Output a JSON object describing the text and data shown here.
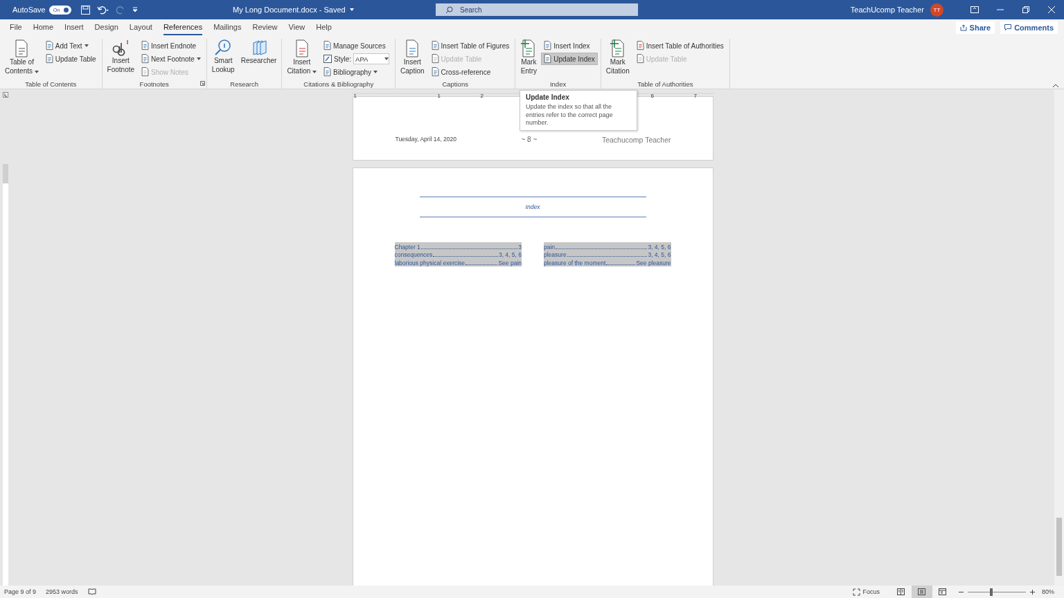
{
  "title_bar": {
    "autosave_label": "AutoSave",
    "autosave_on": true,
    "toggle_text": "On",
    "document_title": "My Long Document.docx  -  Saved",
    "search_placeholder": "Search",
    "user_name": "TeachUcomp Teacher",
    "avatar_initials": "TT"
  },
  "menu_tabs": [
    {
      "label": "File",
      "selected": false
    },
    {
      "label": "Home",
      "selected": false
    },
    {
      "label": "Insert",
      "selected": false
    },
    {
      "label": "Design",
      "selected": false
    },
    {
      "label": "Layout",
      "selected": false
    },
    {
      "label": "References",
      "selected": true
    },
    {
      "label": "Mailings",
      "selected": false
    },
    {
      "label": "Review",
      "selected": false
    },
    {
      "label": "View",
      "selected": false
    },
    {
      "label": "Help",
      "selected": false
    }
  ],
  "share": "Share",
  "comments": "Comments",
  "ribbon_groups": [
    {
      "label": "Table of Contents",
      "large": [
        {
          "lines": [
            "Table of",
            "Contents"
          ],
          "dropdown": true
        }
      ],
      "small": [
        {
          "kind": "button",
          "label": "Add Text",
          "disabled": false,
          "highlighted": false,
          "dropdown": true
        },
        {
          "kind": "button",
          "label": "Update Table",
          "disabled": false,
          "highlighted": false,
          "dropdown": false
        }
      ]
    },
    {
      "label": "Footnotes",
      "launcher": true,
      "large": [
        {
          "lines": [
            "Insert",
            "Footnote"
          ],
          "dropdown": false
        }
      ],
      "small": [
        {
          "kind": "button",
          "label": "Insert Endnote",
          "disabled": false,
          "highlighted": false,
          "dropdown": false
        },
        {
          "kind": "button",
          "label": "Next Footnote",
          "disabled": false,
          "highlighted": false,
          "dropdown": true
        },
        {
          "kind": "button",
          "label": "Show Notes",
          "disabled": true,
          "highlighted": false,
          "dropdown": false
        }
      ]
    },
    {
      "label": "Research",
      "large": [
        {
          "lines": [
            "Smart",
            "Lookup"
          ],
          "dropdown": false
        },
        {
          "lines": [
            "Researcher"
          ],
          "dropdown": false
        }
      ]
    },
    {
      "label": "Citations & Bibliography",
      "large": [
        {
          "lines": [
            "Insert",
            "Citation"
          ],
          "dropdown": true
        }
      ],
      "small": [
        {
          "kind": "button",
          "label": "Manage Sources",
          "disabled": false,
          "highlighted": false,
          "dropdown": false
        },
        {
          "kind": "combo",
          "label": "Style:",
          "value": "APA",
          "disabled": false,
          "highlighted": false,
          "dropdown": true
        },
        {
          "kind": "button",
          "label": "Bibliography",
          "disabled": false,
          "highlighted": false,
          "dropdown": true
        }
      ]
    },
    {
      "label": "Captions",
      "large": [
        {
          "lines": [
            "Insert",
            "Caption"
          ],
          "dropdown": false
        }
      ],
      "small": [
        {
          "kind": "button",
          "label": "Insert Table of Figures",
          "disabled": false,
          "highlighted": false,
          "dropdown": false
        },
        {
          "kind": "button",
          "label": "Update Table",
          "disabled": true,
          "highlighted": false,
          "dropdown": false
        },
        {
          "kind": "button",
          "label": "Cross-reference",
          "disabled": false,
          "highlighted": false,
          "dropdown": false
        }
      ]
    },
    {
      "label": "Index",
      "large": [
        {
          "lines": [
            "Mark",
            "Entry"
          ],
          "dropdown": false
        }
      ],
      "small": [
        {
          "kind": "button",
          "label": "Insert Index",
          "disabled": false,
          "highlighted": false,
          "dropdown": false
        },
        {
          "kind": "button",
          "label": "Update Index",
          "disabled": false,
          "highlighted": true,
          "dropdown": false
        }
      ]
    },
    {
      "label": "Table of Authorities",
      "large": [
        {
          "lines": [
            "Mark",
            "Citation"
          ],
          "dropdown": false
        }
      ],
      "small": [
        {
          "kind": "button",
          "label": "Insert Table of Authorities",
          "disabled": false,
          "highlighted": false,
          "dropdown": false
        },
        {
          "kind": "button",
          "label": "Update Table",
          "disabled": true,
          "highlighted": false,
          "dropdown": false
        }
      ]
    }
  ],
  "ruler_labels": [
    "1",
    "1",
    "2",
    "6",
    "7"
  ],
  "tooltip": {
    "title": "Update Index",
    "body": "Update the index so that all the entries refer to the correct page number."
  },
  "footer": {
    "date": "Tuesday, April 14, 2020",
    "page_number": "~ 8 ~",
    "author": "Teachucomp Teacher"
  },
  "index": {
    "heading": "Index",
    "selected": true,
    "columns": [
      [
        {
          "term": "Chapter 1",
          "pages": "3"
        },
        {
          "term": "consequences",
          "pages": "3, 4, 5, 6"
        },
        {
          "term": "laborious physical exercise",
          "pages": "See pain"
        }
      ],
      [
        {
          "term": "pain",
          "pages": "3, 4, 5, 6"
        },
        {
          "term": "pleasure",
          "pages": "3, 4, 5, 6"
        },
        {
          "term": "pleasure of the moment",
          "pages": "See pleasure"
        }
      ]
    ]
  },
  "status_bar": {
    "page": "Page 9 of 9",
    "words": "2953 words",
    "focus": "Focus",
    "views": [
      {
        "selected": false
      },
      {
        "selected": true
      },
      {
        "selected": false
      }
    ],
    "zoom": {
      "level": 0.4
    },
    "zoom_text": "80%"
  }
}
